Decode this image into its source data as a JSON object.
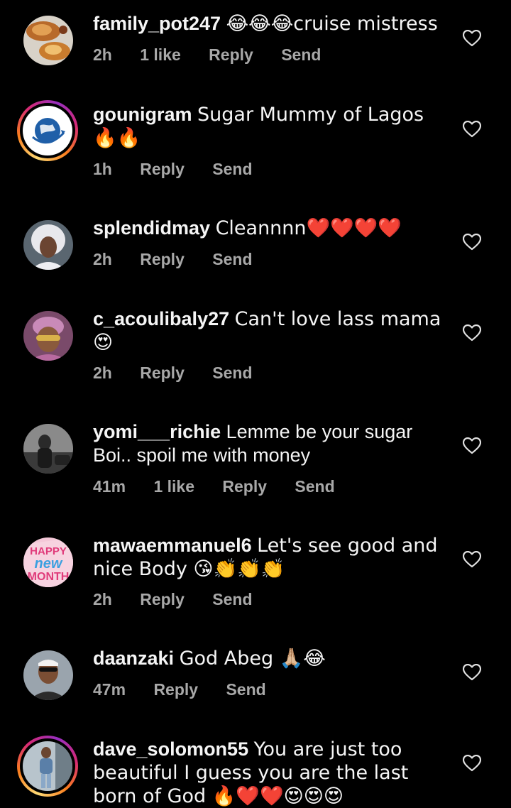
{
  "comments": [
    {
      "username": "family_pot247",
      "text": "😂😂😂cruise mistress",
      "time": "2h",
      "likes": "1 like",
      "reply": "Reply",
      "send": "Send"
    },
    {
      "username": "gounigram",
      "text": "Sugar Mummy of Lagos 🔥🔥",
      "time": "1h",
      "reply": "Reply",
      "send": "Send"
    },
    {
      "username": "splendidmay",
      "text": "Cleannnn❤️❤️❤️❤️",
      "time": "2h",
      "reply": "Reply",
      "send": "Send"
    },
    {
      "username": "c_acoulibaly27",
      "text": "Can't love lass mama 😍",
      "time": "2h",
      "reply": "Reply",
      "send": "Send"
    },
    {
      "username": "yomi___richie",
      "text": "Lemme be your sugar Boi.. spoil me with money",
      "time": "41m",
      "likes": "1 like",
      "reply": "Reply",
      "send": "Send"
    },
    {
      "username": "mawaemmanuel6",
      "text": "Let's see good and nice Body 😘👏👏👏",
      "time": "2h",
      "reply": "Reply",
      "send": "Send"
    },
    {
      "username": "daanzaki",
      "text": "God Abeg 🙏🏼😂",
      "time": "47m",
      "reply": "Reply",
      "send": "Send"
    },
    {
      "username": "dave_solomon55",
      "text": "You are just too beautiful I guess you are the last born of God 🔥❤️❤️😍😍😍",
      "time": "",
      "reply": "",
      "send": ""
    }
  ],
  "icons": {
    "like": "heart-outline-icon"
  },
  "colors": {
    "background": "#000000",
    "text": "#f5f5f5",
    "meta": "#a8a8a8"
  }
}
